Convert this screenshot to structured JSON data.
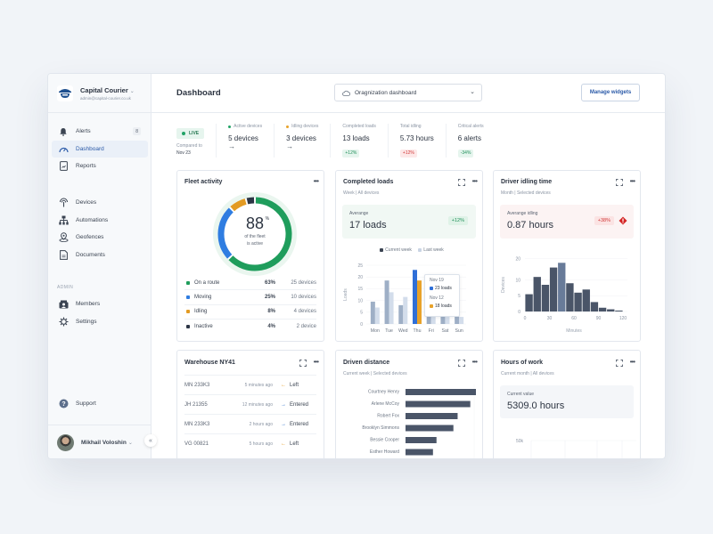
{
  "brand": {
    "name": "Capital Courier",
    "email": "admin@capital-courier.co.uk"
  },
  "sidebar": {
    "items": [
      {
        "label": "Alerts",
        "icon": "bell-icon",
        "badge": "8"
      },
      {
        "label": "Dashboard",
        "icon": "gauge-icon",
        "active": true
      },
      {
        "label": "Reports",
        "icon": "report-icon"
      },
      {
        "label": "Devices",
        "icon": "antenna-icon"
      },
      {
        "label": "Automations",
        "icon": "hierarchy-icon"
      },
      {
        "label": "Geofences",
        "icon": "map-pin-icon"
      },
      {
        "label": "Documents",
        "icon": "document-icon"
      }
    ],
    "admin_label": "ADMIN",
    "admin_items": [
      {
        "label": "Members",
        "icon": "members-icon"
      },
      {
        "label": "Settings",
        "icon": "gear-icon"
      }
    ],
    "support_label": "Support",
    "user_name": "Mikhail Voloshin",
    "collapse_icon": "«"
  },
  "header": {
    "title": "Dashboard",
    "org_select": "Oragnization dashboard",
    "manage_button": "Manage widgets"
  },
  "stats": {
    "live": "LIVE",
    "compared_to": "Compared to",
    "compared_date": "Nov 23",
    "items": [
      {
        "label": "Active devices",
        "value": "5 devices",
        "dot": "#21a366",
        "arrow": "→"
      },
      {
        "label": "Idling devices",
        "value": "3 devices",
        "dot": "#e8a22a",
        "arrow": "→"
      },
      {
        "label": "Completed loads",
        "value": "13 loads",
        "chip": "+12%",
        "chip_type": "up"
      },
      {
        "label": "Total idling",
        "value": "5.73 hours",
        "chip": "+12%",
        "chip_type": "down"
      },
      {
        "label": "Critical alerts",
        "value": "6 alerts",
        "chip": "-34%",
        "chip_type": "up"
      }
    ]
  },
  "fleet": {
    "title": "Fleet activity",
    "percent": "88",
    "percent_sign": "%",
    "caption1": "of the fleet",
    "caption2": "is active",
    "legend": [
      {
        "name": "On a route",
        "pct": "63%",
        "devices": "25 devices",
        "color": "#1f9d5c",
        "share": 63
      },
      {
        "name": "Moving",
        "pct": "25%",
        "devices": "10 devices",
        "color": "#2f7de1",
        "share": 25
      },
      {
        "name": "Idling",
        "pct": "8%",
        "devices": "4 devices",
        "color": "#e39b23",
        "share": 8
      },
      {
        "name": "Inactive",
        "pct": "4%",
        "devices": "2 device",
        "color": "#2c3545",
        "share": 4
      }
    ]
  },
  "loads": {
    "title": "Completed loads",
    "subtitle": "Week | All devices",
    "avg_label": "Averange",
    "avg_value": "17 loads",
    "avg_chip": "+12%",
    "legend_current": "Current week",
    "legend_last": "Last week",
    "y_label": "Loads",
    "tooltip": {
      "date1": "Nov 19",
      "val1": "23 loads",
      "date2": "Nov 12",
      "val2": "18 loads"
    }
  },
  "idling": {
    "title": "Driver idling time",
    "subtitle": "Month | Selected devices",
    "avg_label": "Averange idling",
    "avg_value": "0.87 hours",
    "avg_chip": "+38%",
    "y_label": "Devices",
    "x_label": "Minutes"
  },
  "warehouse": {
    "title": "Warehouse NY41",
    "rows": [
      {
        "id": "MN 233K3",
        "time": "5 minutes ago",
        "status": "Left",
        "arrow": "←",
        "color": "#e39b23"
      },
      {
        "id": "JH 21355",
        "time": "12 minutes ago",
        "status": "Entered",
        "arrow": "→",
        "color": "#2f6fc9"
      },
      {
        "id": "MN 233K3",
        "time": "2 hours ago",
        "status": "Entered",
        "arrow": "→",
        "color": "#2f6fc9"
      },
      {
        "id": "VG 00821",
        "time": "5 hours ago",
        "status": "Left",
        "arrow": "←",
        "color": "#e39b23"
      }
    ]
  },
  "distance": {
    "title": "Driven distance",
    "subtitle": "Current week | Selected devices"
  },
  "hours": {
    "title": "Hours of work",
    "subtitle": "Current month | All devices",
    "current_label": "Current value",
    "current_value": "5309.0 hours",
    "y_tick": "50k"
  },
  "chart_data": [
    {
      "type": "bar",
      "title": "Completed loads",
      "categories": [
        "Mon",
        "Tue",
        "Wed",
        "Thu",
        "Fri",
        "Sat",
        "Sun"
      ],
      "series": [
        {
          "name": "Current week",
          "values": [
            9.5,
            18.5,
            8,
            23,
            5,
            4,
            5
          ]
        },
        {
          "name": "Last week",
          "values": [
            7,
            13.5,
            11.5,
            18.5,
            4,
            3,
            3
          ]
        }
      ],
      "highlight_category": "Thu",
      "ylabel": "Loads",
      "yticks": [
        0,
        5,
        10,
        15,
        20,
        25
      ],
      "ylim": [
        0,
        25
      ],
      "colors": {
        "current": "#9eafc6",
        "last": "#d3ddeb",
        "hl_current": "#2f6fd8",
        "hl_last": "#e8a22a"
      }
    },
    {
      "type": "bar",
      "title": "Driver idling time",
      "xlabel": "Minutes",
      "ylabel": "Devices",
      "xticks": [
        0,
        30,
        60,
        90,
        120
      ],
      "yticks": [
        0,
        5,
        10,
        20
      ],
      "bin_starts": [
        0,
        10,
        20,
        30,
        40,
        50,
        60,
        70,
        80,
        90,
        100,
        110
      ],
      "values": [
        5.5,
        11,
        8.5,
        14,
        15.5,
        9,
        6,
        7,
        3,
        1.2,
        0.7,
        0.3
      ],
      "highlight_bin": 4,
      "colors": {
        "bar": "#4a5568",
        "highlight": "#687b99"
      }
    },
    {
      "type": "bar",
      "title": "Driven distance",
      "categories": [
        "Courtney Henry",
        "Arlene McCoy",
        "Robert Fox",
        "Brooklyn Simmons",
        "Bessie Cooper",
        "Esther Howard"
      ],
      "values": [
        100,
        92,
        74,
        68,
        44,
        39
      ],
      "orientation": "horizontal"
    },
    {
      "type": "bar",
      "title": "Hours of work",
      "yticks_visible": [
        "50k"
      ]
    }
  ]
}
